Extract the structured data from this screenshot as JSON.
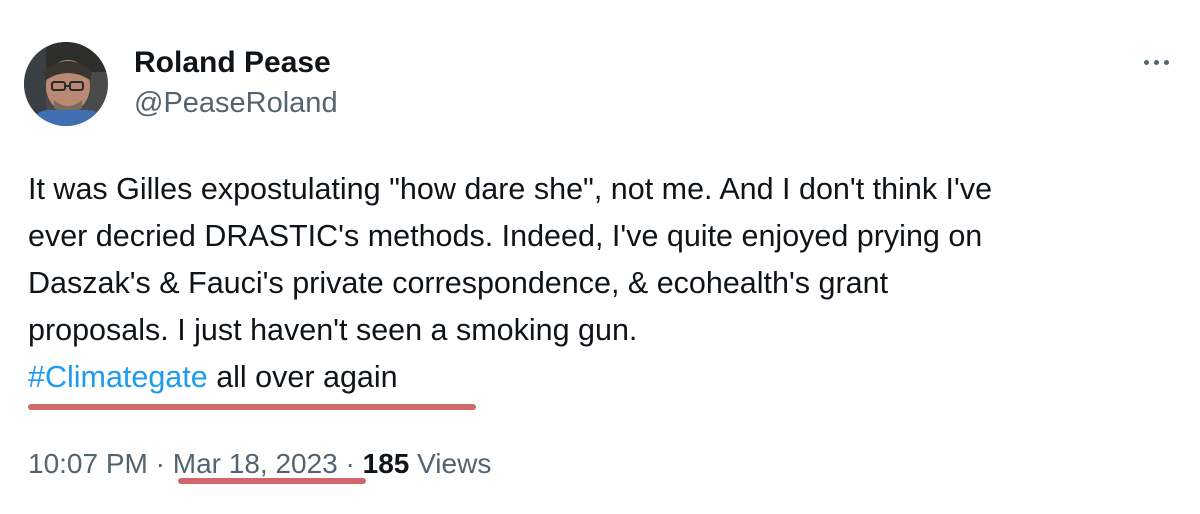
{
  "author": {
    "display_name": "Roland Pease",
    "handle": "@PeaseRoland",
    "avatar_icon": "profile-photo"
  },
  "more_icon": "more-horizontal-icon",
  "tweet": {
    "lines": [
      "It was Gilles expostulating \"how dare she\", not me. And I don't think I've",
      "ever decried DRASTIC's methods. Indeed, I've quite enjoyed prying on",
      "Daszak's & Fauci's private correspondence, & ecohealth's grant",
      "proposals. I just haven't seen a smoking gun."
    ],
    "hashtag": "#Climategate",
    "hashtag_suffix": " all over again"
  },
  "meta": {
    "time": "10:07 PM",
    "separator": "·",
    "date": "Mar 18, 2023",
    "views_count": "185",
    "views_label": "Views"
  },
  "colors": {
    "text_primary": "#0f1419",
    "text_secondary": "#536471",
    "link": "#1d9bf0",
    "highlight_underline": "#d0676b"
  }
}
